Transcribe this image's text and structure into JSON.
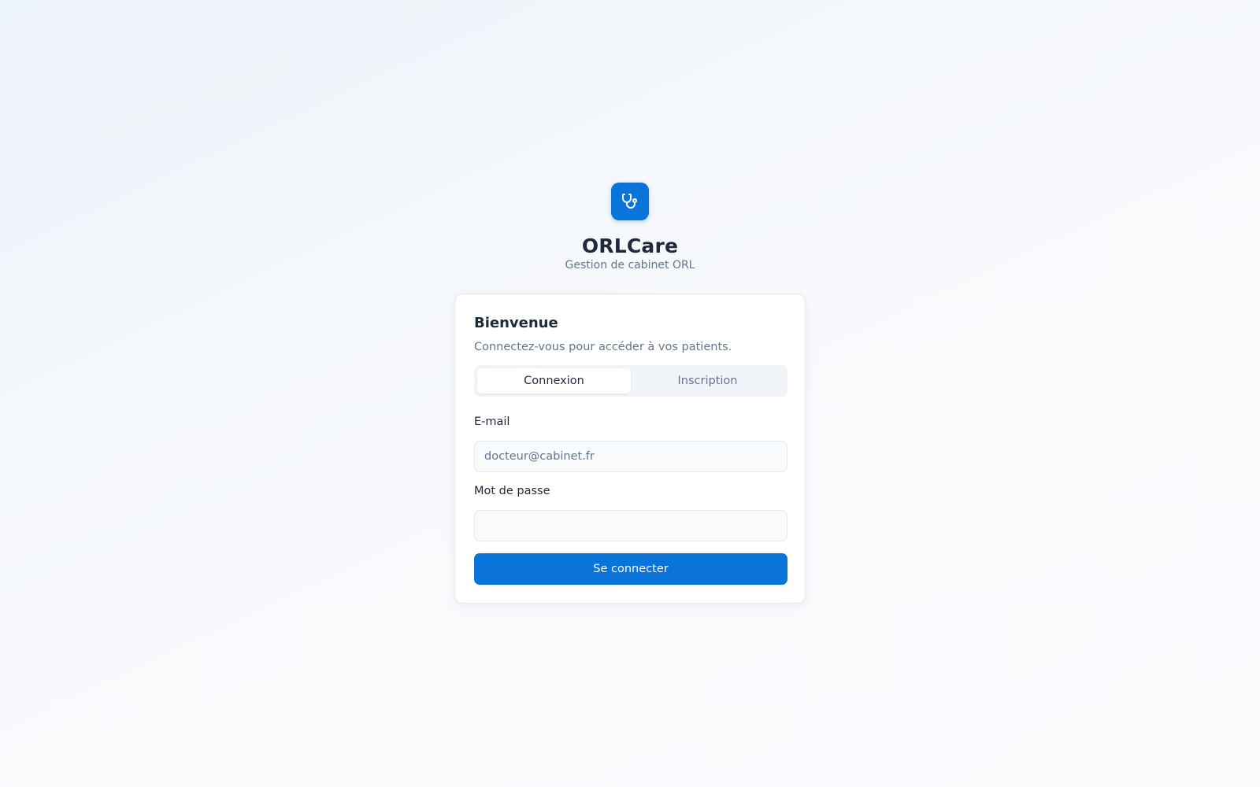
{
  "brand": {
    "name": "ORLCare",
    "tagline": "Gestion de cabinet ORL",
    "logo_icon": "stethoscope-icon",
    "accent_color": "#0b74db"
  },
  "card": {
    "title": "Bienvenue",
    "subtitle": "Connectez-vous pour accéder à vos patients.",
    "tabs": [
      {
        "label": "Connexion",
        "active": true
      },
      {
        "label": "Inscription",
        "active": false
      }
    ],
    "email": {
      "label": "E-mail",
      "placeholder": "docteur@cabinet.fr",
      "value": ""
    },
    "password": {
      "label": "Mot de passe",
      "placeholder": "",
      "value": ""
    },
    "submit_label": "Se connecter"
  }
}
